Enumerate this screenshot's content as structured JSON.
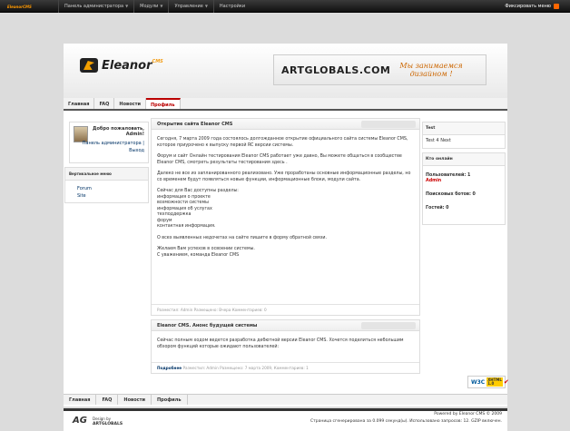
{
  "topbar": {
    "brand": "Eleanor",
    "brand_sub": "CMS",
    "menu": [
      "Панель администратора",
      "Модули",
      "Управление",
      "Настройки"
    ],
    "fix_menu": "Фиксировать меню"
  },
  "header": {
    "logo_text": "Eleanor",
    "logo_sub": "CMS",
    "banner_brand": "ARTGLOBALS.COM",
    "banner_slogan_1": "Мы занимаемся",
    "banner_slogan_2": "дизайном !"
  },
  "nav": [
    "Главная",
    "FAQ",
    "Новости",
    "Профиль"
  ],
  "userbox": {
    "welcome": "Добро пожаловать,",
    "username": "Admin!",
    "admin_link": "Панель администратора |",
    "logout": "Выход"
  },
  "vertical_menu": {
    "title": "Вертикальное меню",
    "items": [
      "Forum",
      "Site"
    ]
  },
  "posts": [
    {
      "title": "Открытие сайта Eleanor CMS",
      "paragraphs": [
        "Сегодня, 7 марта 2009 года состоялось долгожданное открытие официального сайта системы Eleanor CMS, которое приурочено к выпуску первой RC версии системы.",
        "Форум и сайт Онлайн тестирования Eleanor CMS работает уже давно, Вы можете общаться в сообществе Eleanor CMS, смотреть результаты тестирования здесь .",
        "Далеко не все из запланированного реализовано. Уже проработаны основные информационные разделы, но со временем будут появляться новые функции, информационные блоки, модули сайта.",
        "Сейчас для Вас доступны разделы:\nинформация о проекте\nвозможности системы\nинформация об услугах\nтехподдержка\nфорум\nконтактная информация.",
        "О всех выявленных недочетах на сайте пишите в форму обратной связи.",
        "Желаем Вам успехов в освоении системы.\nС уважением, команда Eleanor CMS"
      ],
      "footer": "Разместил: Admin Размещено: Вчера Комментариев: 0"
    },
    {
      "title": "Eleanor CMS. Анонс будущей системы",
      "paragraphs": [
        "Сейчас полным ходом ведется разработка дебютной версии Eleanor CMS. Хочется поделиться небольшим обзором функций которые ожидают пользователей:"
      ],
      "more": "Подробнее",
      "footer": "Разместил: Admin Размещено: 7 марта 2009, Комментариев: 1"
    }
  ],
  "right": {
    "test_title": "Test",
    "test_text": "Test 4 Next",
    "online_title": "Кто онлайн",
    "users_label": "Пользователей: 1",
    "users_name": "Admin",
    "bots_label": "Поисковых ботов: 0",
    "guests_label": "Гостей: 0"
  },
  "w3c": {
    "logo": "W3C",
    "badge_1": "XHTML",
    "badge_2": "1.0"
  },
  "bottomnav": [
    "Главная",
    "FAQ",
    "Новости",
    "Профиль"
  ],
  "footer": {
    "ag_logo": "AG",
    "design_by": "Design by",
    "design_name": "ARTGLOBALS",
    "powered": "Powered by Eleanor CMS © 2009",
    "stats": "Страница сгенерирована за 0.099 секунд(ы). Использовано запросов: 12. GZIP включен."
  },
  "colors": {
    "topbar": "#1a1a1a",
    "accent": "#b00000",
    "link": "#003366",
    "background": "#dcdcdc"
  }
}
